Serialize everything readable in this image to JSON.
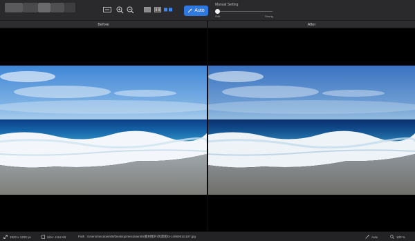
{
  "toolbar": {
    "auto_label": "Auto",
    "manual_setting_label": "Manual Setting",
    "slider_left_label": "Soft",
    "slider_right_label": "Strong",
    "slider_value": 0.0,
    "accent_color": "#2f78e0"
  },
  "headers": {
    "before_label": "Before",
    "after_label": "After"
  },
  "status": {
    "dimensions": "1920 x 1200 px",
    "size": "Size: 4.54 KB",
    "path": "Path : /Users/mecdown09/Desktop/mecdown09/素材图片/风景图/3-1408091G107.jpg",
    "mode": "Auto",
    "zoom": "100 %"
  },
  "icons": {
    "compare_rect": "compare-rect-icon",
    "zoom_in": "zoom-in-icon",
    "zoom_out": "zoom-out-icon",
    "single_view": "single-view-icon",
    "split_view": "split-view-icon",
    "side_by_side": "side-by-side-icon",
    "wand": "magic-wand-icon"
  }
}
